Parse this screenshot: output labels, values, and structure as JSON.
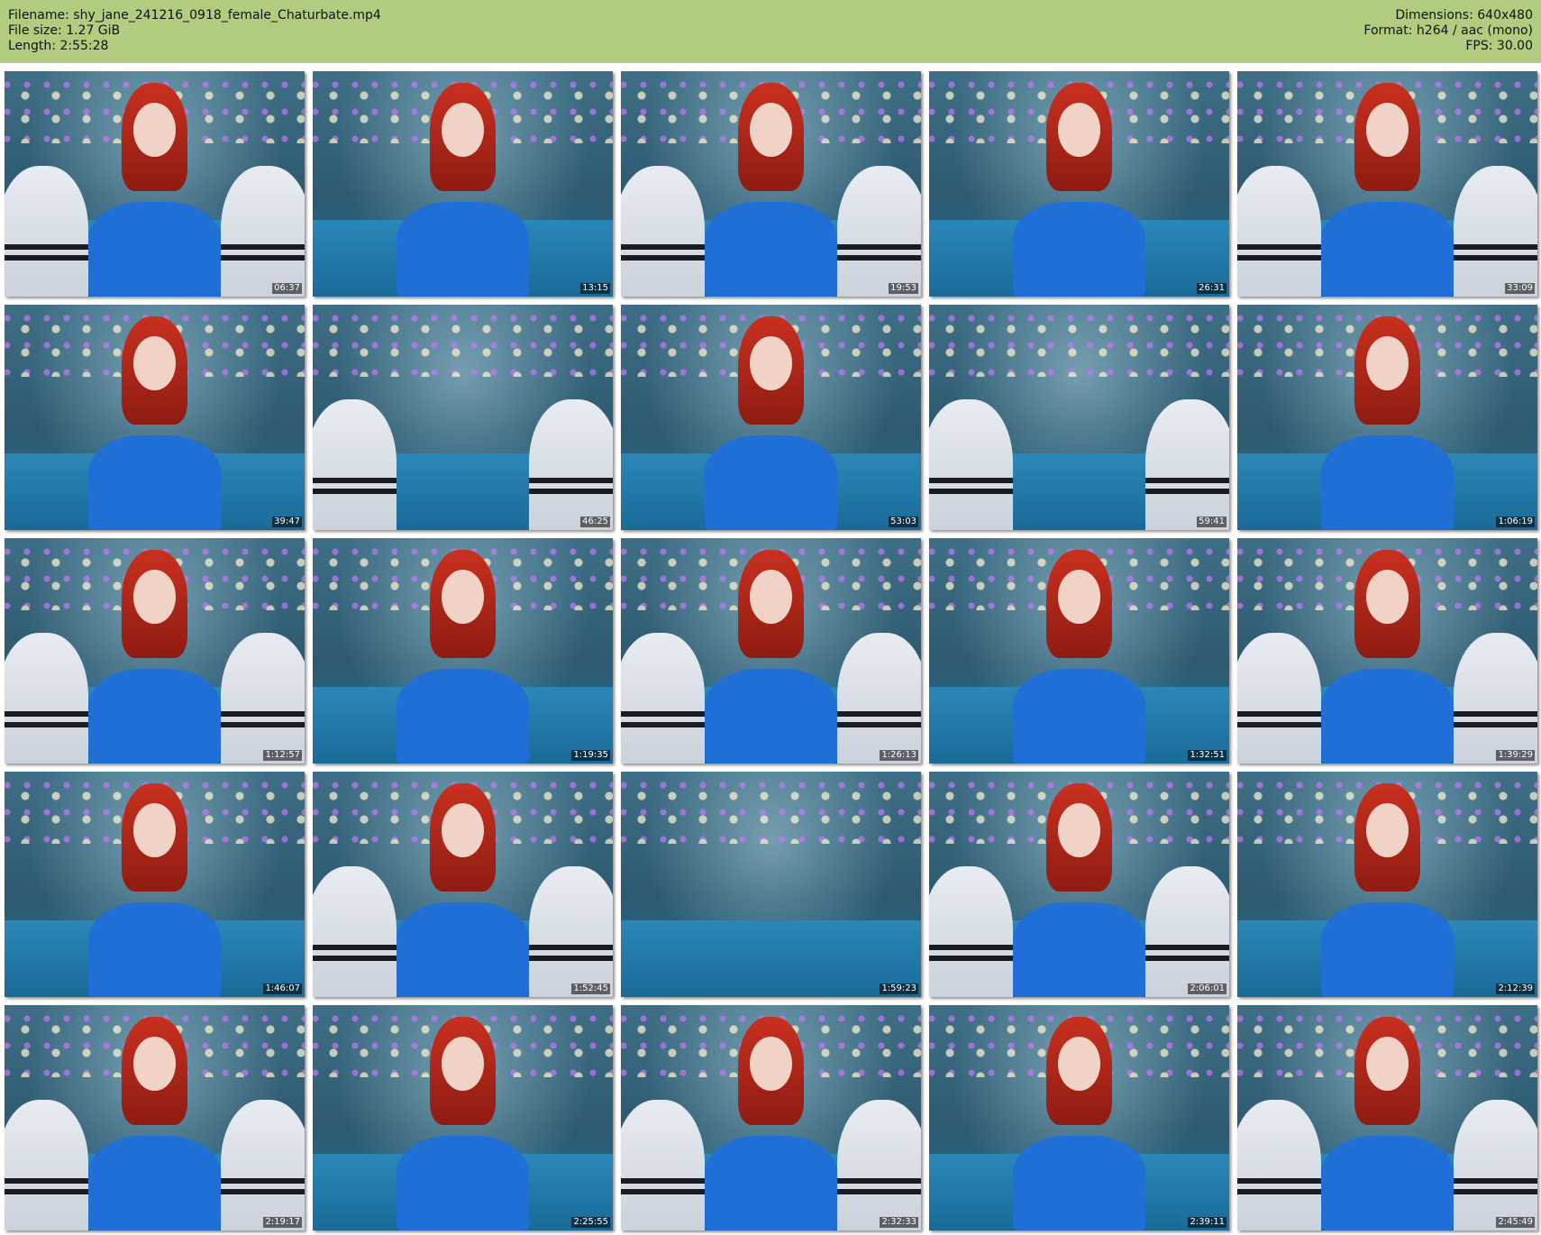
{
  "header": {
    "filename_line": "Filename: shy_jane_241216_0918_female_Chaturbate.mp4",
    "filesize_line": "File size: 1.27 GiB",
    "length_line": "Length: 2:55:28",
    "dimensions_line": "Dimensions: 640x480",
    "format_line": "Format: h264 / aac (mono)",
    "fps_line": "FPS: 30.00"
  },
  "thumbnails": [
    {
      "ts": "06:37"
    },
    {
      "ts": "13:15"
    },
    {
      "ts": "19:53"
    },
    {
      "ts": "26:31"
    },
    {
      "ts": "33:09"
    },
    {
      "ts": "39:47"
    },
    {
      "ts": "46:25"
    },
    {
      "ts": "53:03"
    },
    {
      "ts": "59:41"
    },
    {
      "ts": "1:06:19"
    },
    {
      "ts": "1:12:57"
    },
    {
      "ts": "1:19:35"
    },
    {
      "ts": "1:26:13"
    },
    {
      "ts": "1:32:51"
    },
    {
      "ts": "1:39:29"
    },
    {
      "ts": "1:46:07"
    },
    {
      "ts": "1:52:45"
    },
    {
      "ts": "1:59:23"
    },
    {
      "ts": "2:06:01"
    },
    {
      "ts": "2:12:39"
    },
    {
      "ts": "2:19:17"
    },
    {
      "ts": "2:25:55"
    },
    {
      "ts": "2:32:33"
    },
    {
      "ts": "2:39:11"
    },
    {
      "ts": "2:45:49"
    }
  ],
  "colors": {
    "header_bg": "#b0cc7e",
    "shirt": "#1f6fd6",
    "hair": "#c9301f"
  }
}
